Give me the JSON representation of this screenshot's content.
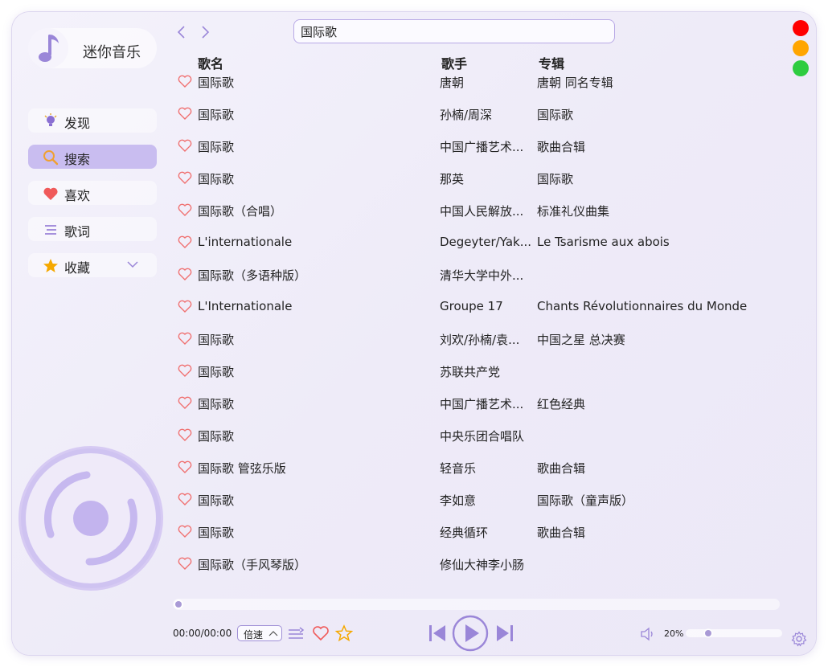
{
  "app": {
    "title": "迷你音乐"
  },
  "sidebar": {
    "items": [
      {
        "label": "发现",
        "icon": "bulb-icon"
      },
      {
        "label": "搜索",
        "icon": "search-icon",
        "active": true
      },
      {
        "label": "喜欢",
        "icon": "heart-icon"
      },
      {
        "label": "歌词",
        "icon": "lyrics-icon"
      },
      {
        "label": "收藏",
        "icon": "star-icon"
      }
    ]
  },
  "search": {
    "value": "国际歌",
    "placeholder": ""
  },
  "table": {
    "headers": {
      "name": "歌名",
      "artist": "歌手",
      "album": "专辑"
    },
    "rows": [
      {
        "name": "国际歌",
        "artist": "唐朝",
        "album": "唐朝 同名专辑"
      },
      {
        "name": "国际歌",
        "artist": "孙楠/周深",
        "album": "国际歌"
      },
      {
        "name": "国际歌",
        "artist": "中国广播艺术...",
        "album": "歌曲合辑"
      },
      {
        "name": "国际歌",
        "artist": "那英",
        "album": "国际歌"
      },
      {
        "name": "国际歌（合唱）",
        "artist": "中国人民解放...",
        "album": "标准礼仪曲集"
      },
      {
        "name": "L'internationale",
        "artist": "Degeyter/Yak...",
        "album": "Le Tsarisme aux abois"
      },
      {
        "name": "国际歌（多语种版）",
        "artist": "清华大学中外...",
        "album": ""
      },
      {
        "name": "L'Internationale",
        "artist": "Groupe 17",
        "album": "Chants Révolutionnaires du Monde"
      },
      {
        "name": "国际歌",
        "artist": "刘欢/孙楠/袁...",
        "album": "中国之星 总决赛"
      },
      {
        "name": "国际歌",
        "artist": "苏联共产党",
        "album": ""
      },
      {
        "name": "国际歌",
        "artist": "中国广播艺术...",
        "album": "红色经典"
      },
      {
        "name": "国际歌",
        "artist": "中央乐团合唱队",
        "album": ""
      },
      {
        "name": "国际歌 管弦乐版",
        "artist": "轻音乐",
        "album": "歌曲合辑"
      },
      {
        "name": "国际歌",
        "artist": "李如意",
        "album": "国际歌（童声版）"
      },
      {
        "name": "国际歌",
        "artist": "经典循环",
        "album": "歌曲合辑"
      },
      {
        "name": "国际歌（手风琴版）",
        "artist": "修仙大神李小肠",
        "album": ""
      }
    ]
  },
  "player": {
    "time": "00:00/00:00",
    "speed_label": "倍速",
    "progress": 0,
    "volume_label": "20%",
    "volume": 0.2
  },
  "colors": {
    "accent": "#9a86d8",
    "close": "#ff0000",
    "minimize": "#ffa500",
    "maximize": "#2ecc40",
    "heart": "#f07070",
    "star": "#f5a800"
  }
}
